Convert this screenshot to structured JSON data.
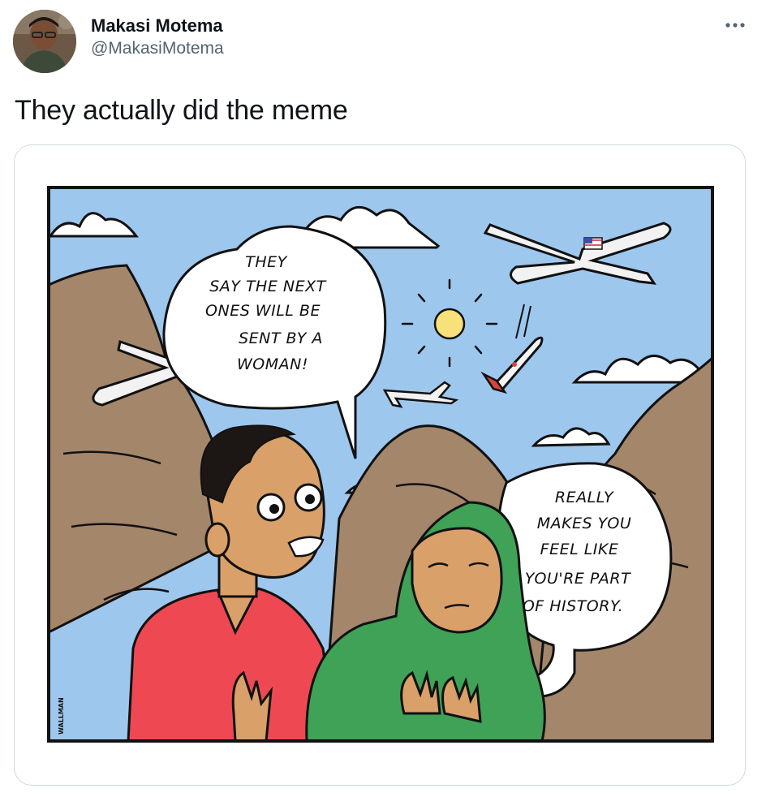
{
  "tweet": {
    "author": {
      "display_name": "Makasi Motema",
      "handle": "@MakasiMotema",
      "avatar_icon": "profile-photo"
    },
    "more_icon": "ellipsis-icon",
    "text": "They actually did the meme"
  },
  "comic": {
    "speech_left_lines": [
      "THEY",
      "SAY THE NEXT",
      "ONES WILL BE",
      "SENT BY A",
      "WOMAN!"
    ],
    "speech_right_lines": [
      "REALLY",
      "MAKES YOU",
      "FEEL LIKE",
      "YOU'RE PART",
      "OF HISTORY."
    ],
    "signature": "WALLMAN",
    "colors": {
      "sky": "#9ec7ee",
      "mountain": "#a4866b",
      "red_shirt": "#ee4952",
      "green_hijab": "#3fa257",
      "skin": "#d9a06a",
      "sun": "#f8e07a"
    }
  }
}
